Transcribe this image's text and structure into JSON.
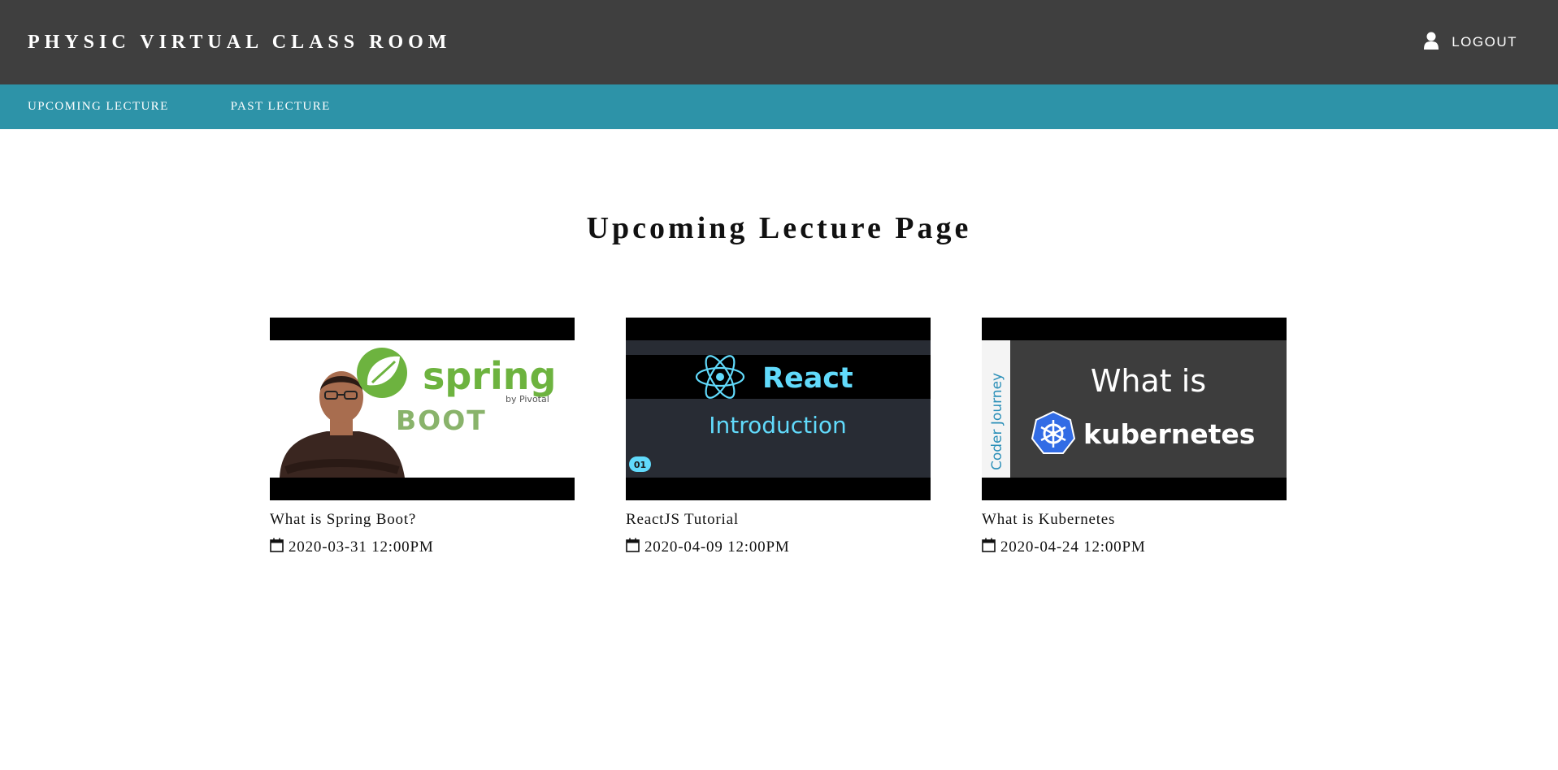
{
  "header": {
    "brand": "PHYSIC VIRTUAL CLASS ROOM",
    "logout_label": "LOGOUT",
    "logout_icon": "user-icon"
  },
  "nav": {
    "items": [
      {
        "label": "UPCOMING LECTURE"
      },
      {
        "label": "PAST LECTURE"
      }
    ]
  },
  "main": {
    "title": "Upcoming Lecture Page",
    "lectures": [
      {
        "title": "What is Spring Boot?",
        "date": "2020-03-31 12:00PM",
        "thumb": {
          "brand": "spring",
          "sub": "BOOT",
          "by": "by Pivotal"
        }
      },
      {
        "title": "ReactJS Tutorial",
        "date": "2020-04-09 12:00PM",
        "thumb": {
          "brand": "React",
          "sub": "Introduction",
          "badge": "01"
        }
      },
      {
        "title": "What is Kubernetes",
        "date": "2020-04-24 12:00PM",
        "thumb": {
          "side": "Coder Journey",
          "line1": "What is",
          "brand": "kubernetes"
        }
      }
    ]
  },
  "colors": {
    "topbar": "#3f3f3f",
    "navbar": "#2d93a8",
    "spring_green": "#6db33f",
    "react_cyan": "#61dafb",
    "k8s_blue": "#326ce5"
  }
}
